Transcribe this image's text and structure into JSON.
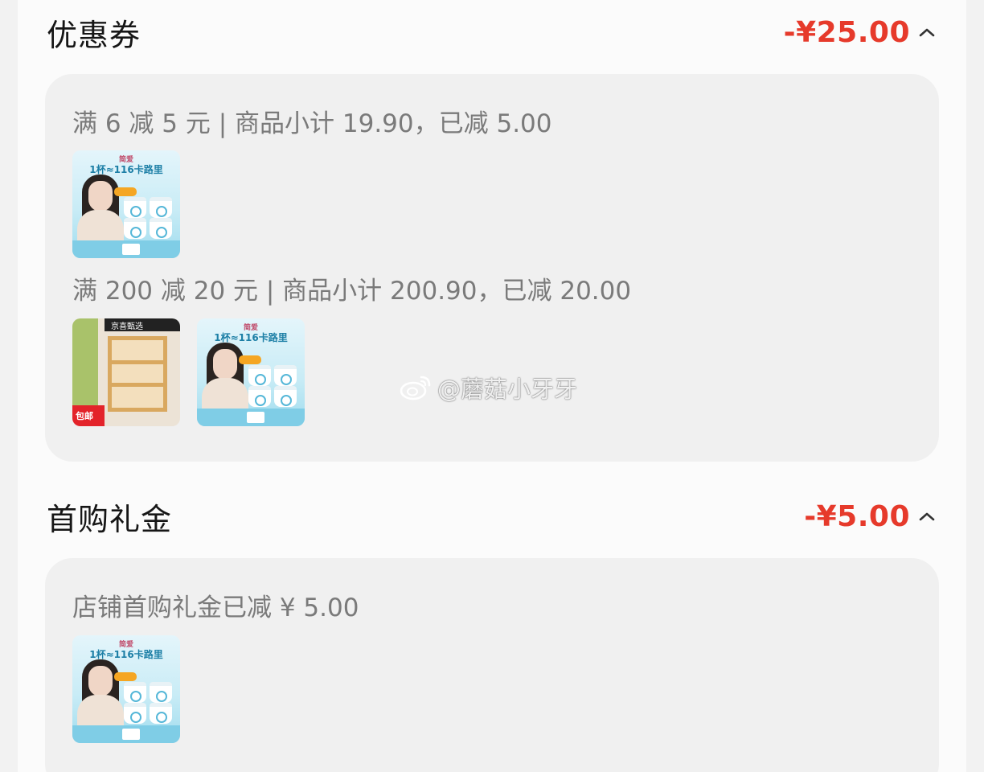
{
  "coupon": {
    "title": "优惠券",
    "amount": "-¥25.00",
    "rules": [
      {
        "text": "满 6 减 5 元 | 商品小计 19.90，已减 5.00"
      },
      {
        "text": "满 200 减 20 元 | 商品小计 200.90，已减 20.00"
      }
    ]
  },
  "first_purchase": {
    "title": "首购礼金",
    "amount": "-¥5.00",
    "rule_text": "店铺首购礼金已减 ¥ 5.00"
  },
  "product_images": {
    "yogurt": {
      "brand": "简爱",
      "headline": "1杯≈116卡路里",
      "icon": "yogurt-product-image"
    },
    "furniture": {
      "banner": "京喜甄选",
      "badge": "包邮",
      "icon": "bookshelf-product-image"
    }
  },
  "watermark": {
    "text": "@蘑菇小牙牙",
    "icon": "weibo-icon"
  },
  "colors": {
    "accent": "#e63a2b",
    "muted_text": "#7a7a7a",
    "card_bg": "#f0f0f0"
  },
  "icons": {
    "collapse": "chevron-up-icon"
  }
}
